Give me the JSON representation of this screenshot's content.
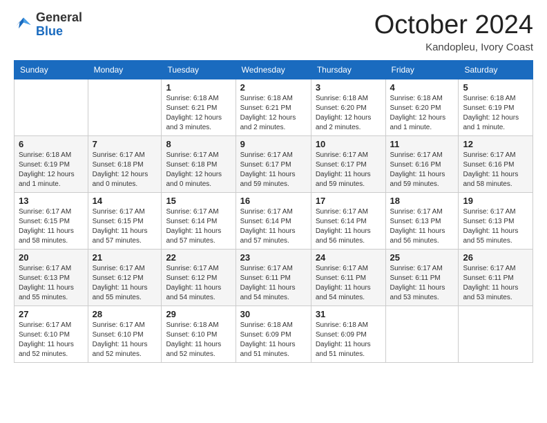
{
  "logo": {
    "general": "General",
    "blue": "Blue"
  },
  "header": {
    "month": "October 2024",
    "location": "Kandopleu, Ivory Coast"
  },
  "weekdays": [
    "Sunday",
    "Monday",
    "Tuesday",
    "Wednesday",
    "Thursday",
    "Friday",
    "Saturday"
  ],
  "weeks": [
    [
      {
        "day": "",
        "sunrise": "",
        "sunset": "",
        "daylight": ""
      },
      {
        "day": "",
        "sunrise": "",
        "sunset": "",
        "daylight": ""
      },
      {
        "day": "1",
        "sunrise": "Sunrise: 6:18 AM",
        "sunset": "Sunset: 6:21 PM",
        "daylight": "Daylight: 12 hours and 3 minutes."
      },
      {
        "day": "2",
        "sunrise": "Sunrise: 6:18 AM",
        "sunset": "Sunset: 6:21 PM",
        "daylight": "Daylight: 12 hours and 2 minutes."
      },
      {
        "day": "3",
        "sunrise": "Sunrise: 6:18 AM",
        "sunset": "Sunset: 6:20 PM",
        "daylight": "Daylight: 12 hours and 2 minutes."
      },
      {
        "day": "4",
        "sunrise": "Sunrise: 6:18 AM",
        "sunset": "Sunset: 6:20 PM",
        "daylight": "Daylight: 12 hours and 1 minute."
      },
      {
        "day": "5",
        "sunrise": "Sunrise: 6:18 AM",
        "sunset": "Sunset: 6:19 PM",
        "daylight": "Daylight: 12 hours and 1 minute."
      }
    ],
    [
      {
        "day": "6",
        "sunrise": "Sunrise: 6:18 AM",
        "sunset": "Sunset: 6:19 PM",
        "daylight": "Daylight: 12 hours and 1 minute."
      },
      {
        "day": "7",
        "sunrise": "Sunrise: 6:17 AM",
        "sunset": "Sunset: 6:18 PM",
        "daylight": "Daylight: 12 hours and 0 minutes."
      },
      {
        "day": "8",
        "sunrise": "Sunrise: 6:17 AM",
        "sunset": "Sunset: 6:18 PM",
        "daylight": "Daylight: 12 hours and 0 minutes."
      },
      {
        "day": "9",
        "sunrise": "Sunrise: 6:17 AM",
        "sunset": "Sunset: 6:17 PM",
        "daylight": "Daylight: 11 hours and 59 minutes."
      },
      {
        "day": "10",
        "sunrise": "Sunrise: 6:17 AM",
        "sunset": "Sunset: 6:17 PM",
        "daylight": "Daylight: 11 hours and 59 minutes."
      },
      {
        "day": "11",
        "sunrise": "Sunrise: 6:17 AM",
        "sunset": "Sunset: 6:16 PM",
        "daylight": "Daylight: 11 hours and 59 minutes."
      },
      {
        "day": "12",
        "sunrise": "Sunrise: 6:17 AM",
        "sunset": "Sunset: 6:16 PM",
        "daylight": "Daylight: 11 hours and 58 minutes."
      }
    ],
    [
      {
        "day": "13",
        "sunrise": "Sunrise: 6:17 AM",
        "sunset": "Sunset: 6:15 PM",
        "daylight": "Daylight: 11 hours and 58 minutes."
      },
      {
        "day": "14",
        "sunrise": "Sunrise: 6:17 AM",
        "sunset": "Sunset: 6:15 PM",
        "daylight": "Daylight: 11 hours and 57 minutes."
      },
      {
        "day": "15",
        "sunrise": "Sunrise: 6:17 AM",
        "sunset": "Sunset: 6:14 PM",
        "daylight": "Daylight: 11 hours and 57 minutes."
      },
      {
        "day": "16",
        "sunrise": "Sunrise: 6:17 AM",
        "sunset": "Sunset: 6:14 PM",
        "daylight": "Daylight: 11 hours and 57 minutes."
      },
      {
        "day": "17",
        "sunrise": "Sunrise: 6:17 AM",
        "sunset": "Sunset: 6:14 PM",
        "daylight": "Daylight: 11 hours and 56 minutes."
      },
      {
        "day": "18",
        "sunrise": "Sunrise: 6:17 AM",
        "sunset": "Sunset: 6:13 PM",
        "daylight": "Daylight: 11 hours and 56 minutes."
      },
      {
        "day": "19",
        "sunrise": "Sunrise: 6:17 AM",
        "sunset": "Sunset: 6:13 PM",
        "daylight": "Daylight: 11 hours and 55 minutes."
      }
    ],
    [
      {
        "day": "20",
        "sunrise": "Sunrise: 6:17 AM",
        "sunset": "Sunset: 6:13 PM",
        "daylight": "Daylight: 11 hours and 55 minutes."
      },
      {
        "day": "21",
        "sunrise": "Sunrise: 6:17 AM",
        "sunset": "Sunset: 6:12 PM",
        "daylight": "Daylight: 11 hours and 55 minutes."
      },
      {
        "day": "22",
        "sunrise": "Sunrise: 6:17 AM",
        "sunset": "Sunset: 6:12 PM",
        "daylight": "Daylight: 11 hours and 54 minutes."
      },
      {
        "day": "23",
        "sunrise": "Sunrise: 6:17 AM",
        "sunset": "Sunset: 6:11 PM",
        "daylight": "Daylight: 11 hours and 54 minutes."
      },
      {
        "day": "24",
        "sunrise": "Sunrise: 6:17 AM",
        "sunset": "Sunset: 6:11 PM",
        "daylight": "Daylight: 11 hours and 54 minutes."
      },
      {
        "day": "25",
        "sunrise": "Sunrise: 6:17 AM",
        "sunset": "Sunset: 6:11 PM",
        "daylight": "Daylight: 11 hours and 53 minutes."
      },
      {
        "day": "26",
        "sunrise": "Sunrise: 6:17 AM",
        "sunset": "Sunset: 6:11 PM",
        "daylight": "Daylight: 11 hours and 53 minutes."
      }
    ],
    [
      {
        "day": "27",
        "sunrise": "Sunrise: 6:17 AM",
        "sunset": "Sunset: 6:10 PM",
        "daylight": "Daylight: 11 hours and 52 minutes."
      },
      {
        "day": "28",
        "sunrise": "Sunrise: 6:17 AM",
        "sunset": "Sunset: 6:10 PM",
        "daylight": "Daylight: 11 hours and 52 minutes."
      },
      {
        "day": "29",
        "sunrise": "Sunrise: 6:18 AM",
        "sunset": "Sunset: 6:10 PM",
        "daylight": "Daylight: 11 hours and 52 minutes."
      },
      {
        "day": "30",
        "sunrise": "Sunrise: 6:18 AM",
        "sunset": "Sunset: 6:09 PM",
        "daylight": "Daylight: 11 hours and 51 minutes."
      },
      {
        "day": "31",
        "sunrise": "Sunrise: 6:18 AM",
        "sunset": "Sunset: 6:09 PM",
        "daylight": "Daylight: 11 hours and 51 minutes."
      },
      {
        "day": "",
        "sunrise": "",
        "sunset": "",
        "daylight": ""
      },
      {
        "day": "",
        "sunrise": "",
        "sunset": "",
        "daylight": ""
      }
    ]
  ]
}
